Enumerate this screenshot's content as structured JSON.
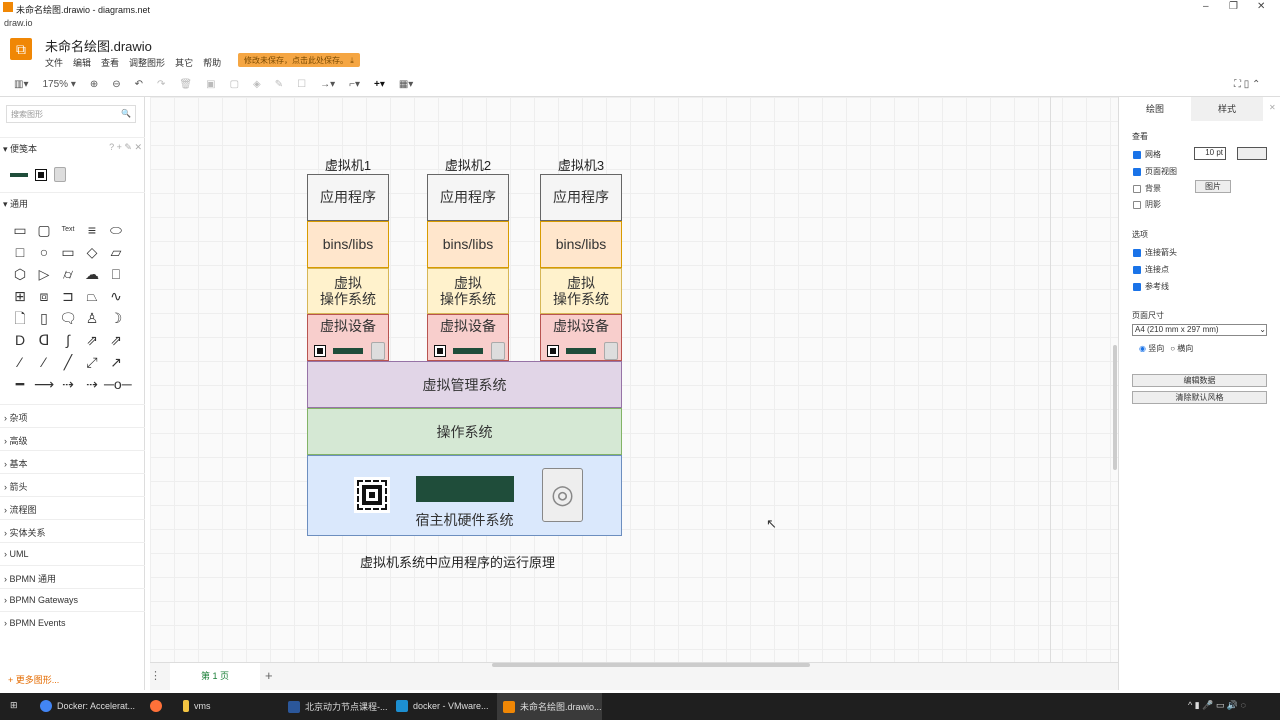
{
  "window": {
    "title": "未命名绘图.drawio - diagrams.net",
    "subtitle": "draw.io"
  },
  "app": {
    "doc_title": "未命名绘图.drawio",
    "menu": [
      "文件",
      "编辑",
      "查看",
      "调整图形",
      "其它",
      "帮助"
    ],
    "save_notice": "修改未保存，点击此处保存。"
  },
  "toolbar": {
    "zoom": "175%"
  },
  "sidebar": {
    "search_placeholder": "搜索图形",
    "scratchpad": "便笺本",
    "general": "通用",
    "text_shape": "Text",
    "categories": [
      "杂项",
      "高级",
      "基本",
      "箭头",
      "流程图",
      "实体关系",
      "UML",
      "BPMN 通用",
      "BPMN Gateways",
      "BPMN Events"
    ],
    "more": "+ 更多图形..."
  },
  "diagram": {
    "vms": [
      {
        "name": "虚拟机1"
      },
      {
        "name": "虚拟机2"
      },
      {
        "name": "虚拟机3"
      }
    ],
    "app_layer": "应用程序",
    "libs_layer": "bins/libs",
    "guest_os_line1": "虚拟",
    "guest_os_line2": "操作系统",
    "vdevice": "虚拟设备",
    "hypervisor": "虚拟管理系统",
    "host_os": "操作系统",
    "hardware": "宿主机硬件系统",
    "caption": "虚拟机系统中应用程序的运行原理",
    "colors": {
      "app": "#f5f5f5",
      "libs": "#ffe6cc",
      "guest_os": "#fff2cc",
      "vdevice": "#f8cecc",
      "hypervisor": "#e1d5e7",
      "host_os": "#d5e8d4",
      "hardware": "#dae8fc"
    }
  },
  "right_panel": {
    "tabs": [
      "绘图",
      "样式"
    ],
    "view": "查看",
    "grid": "网格",
    "grid_size": "10 pt",
    "page_view": "页面视图",
    "background": "背景",
    "image_btn": "图片",
    "shadow": "阴影",
    "options": "选项",
    "connection_arrows": "连接箭头",
    "connection_points": "连接点",
    "guides": "参考线",
    "page_size": "页面尺寸",
    "page_size_value": "A4 (210 mm x 297 mm)",
    "portrait": "竖向",
    "landscape": "横向",
    "edit_data": "编辑数据",
    "clear_style": "清除默认风格"
  },
  "pages": {
    "tab": "第 1 页"
  },
  "taskbar": {
    "items": [
      "Docker: Accelerat...",
      "",
      "vms",
      "北京动力节点课程-...",
      "docker - VMware...",
      "未命名绘图.drawio..."
    ]
  }
}
